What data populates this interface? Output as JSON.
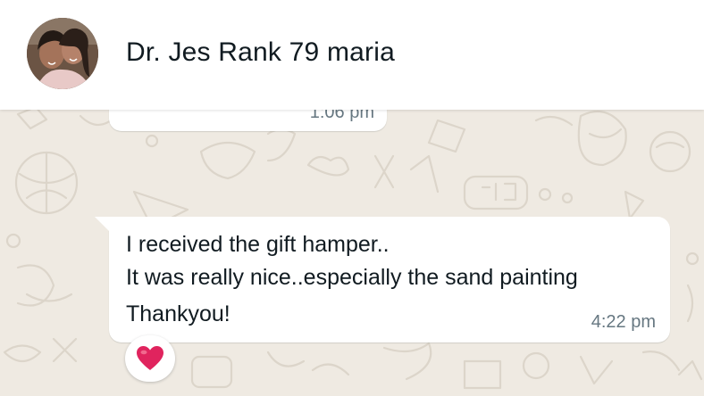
{
  "header": {
    "contact_name": "Dr. Jes Rank 79 maria",
    "avatar_icon": "contact-photo"
  },
  "messages": [
    {
      "time": "1:06 pm",
      "partial": true
    },
    {
      "lines": [
        "I received the gift hamper..",
        "It was really nice..especially the sand painting",
        "Thankyou!"
      ],
      "time": "4:22 pm",
      "reaction": {
        "icon": "red-heart-icon",
        "color": "#e0245e"
      }
    }
  ],
  "colors": {
    "chat_background": "#efeae2",
    "bubble": "#ffffff",
    "timestamp": "#667781"
  }
}
